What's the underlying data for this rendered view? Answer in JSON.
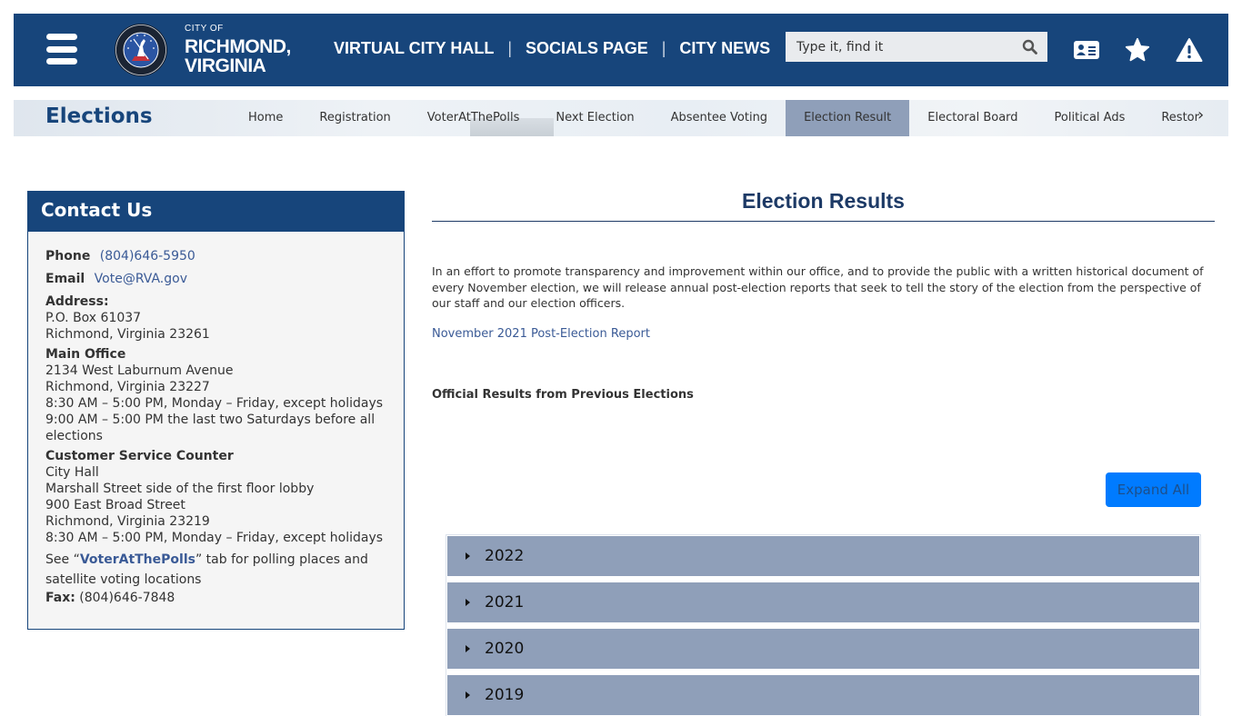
{
  "header": {
    "brand_small": "CITY OF",
    "brand_line1": "RICHMOND,",
    "brand_line2": "VIRGINIA",
    "nav": [
      {
        "label": "VIRTUAL CITY HALL"
      },
      {
        "label": "SOCIALS PAGE"
      },
      {
        "label": "CITY NEWS"
      }
    ],
    "separator": "|",
    "search_placeholder": "Type it, find it",
    "search_value": "",
    "icons": [
      "menu-icon",
      "city-seal",
      "search-icon",
      "contact-card-icon",
      "star-icon",
      "alert-icon"
    ],
    "colors": {
      "primary": "#17457b"
    }
  },
  "subnav": {
    "title": "Elections",
    "items": [
      {
        "label": "Home",
        "active": false
      },
      {
        "label": "Registration",
        "active": false
      },
      {
        "label": "VoterAtThePolls",
        "active": false
      },
      {
        "label": "Next Election",
        "active": false
      },
      {
        "label": "Absentee Voting",
        "active": false
      },
      {
        "label": "Election Result",
        "active": true
      },
      {
        "label": "Electoral Board",
        "active": false
      },
      {
        "label": "Political Ads",
        "active": false
      },
      {
        "label": "Restoration",
        "active": false
      }
    ],
    "next_arrow": "›",
    "active_color": "#8f9fb9"
  },
  "contact": {
    "title": "Contact Us",
    "phone_label": "Phone",
    "phone": "(804)646-5950",
    "email_label": "Email",
    "email": "Vote@RVA.gov",
    "address_label": "Address:",
    "address_lines": [
      "P.O. Box 61037",
      "Richmond, Virginia 23261"
    ],
    "main_office_label": "Main Office",
    "main_office_lines": [
      "2134 West Laburnum Avenue",
      "Richmond, Virginia 23227",
      "8:30 AM – 5:00 PM, Monday – Friday, except holidays",
      "9:00 AM – 5:00 PM the last two Saturdays before all elections"
    ],
    "counter_label": "Customer Service Counter",
    "counter_lines": [
      "City Hall",
      "Marshall Street side of the first floor lobby",
      "900 East Broad Street",
      "Richmond, Virginia 23219",
      "8:30 AM – 5:00 PM, Monday – Friday, except holidays"
    ],
    "see_prefix": "See “",
    "see_link": "VoterAtThePolls",
    "see_suffix": "” tab for polling places and satellite voting locations",
    "fax_label": "Fax:",
    "fax": "(804)646-7848"
  },
  "main": {
    "title": "Election Results",
    "intro": "In an effort to promote transparency and improvement within our office, and to provide the public with a written historical document of every November election, we will release annual post-election reports that seek to tell the story of the election from the perspective of our staff and our election officers.",
    "report_link": "November 2021 Post-Election Report",
    "official_heading": "Official Results from Previous Elections",
    "expand_all": "Expand All",
    "years": [
      "2022",
      "2021",
      "2020",
      "2019"
    ]
  }
}
